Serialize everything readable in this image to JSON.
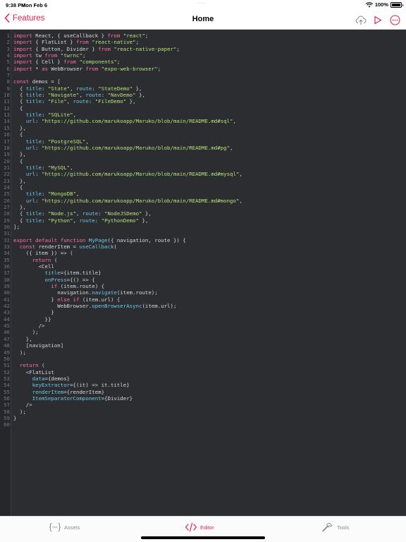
{
  "status_bar": {
    "time": "9:38 PM",
    "date": "Mon Feb 6",
    "battery": "100%",
    "battery_level": 1.0
  },
  "navbar": {
    "back_label": "Features",
    "title": "Home",
    "actions": [
      "cloud-upload-icon",
      "play-icon",
      "more-icon"
    ]
  },
  "colors": {
    "accent": "#e5254d",
    "editor_bg": "#2b2d31",
    "keyword": "#ff6fa8",
    "string": "#b6e07a",
    "property": "#6fc6e8"
  },
  "editor": {
    "lines": [
      [
        [
          "kw",
          "import"
        ],
        [
          "pl",
          " React, { useCallback } "
        ],
        [
          "kw",
          "from"
        ],
        [
          "pl",
          " "
        ],
        [
          "str",
          "\"react\""
        ],
        [
          "pl",
          ";"
        ]
      ],
      [
        [
          "kw",
          "import"
        ],
        [
          "pl",
          " { FlatList } "
        ],
        [
          "kw",
          "from"
        ],
        [
          "pl",
          " "
        ],
        [
          "str",
          "\"react-native\""
        ],
        [
          "pl",
          ";"
        ]
      ],
      [
        [
          "kw",
          "import"
        ],
        [
          "pl",
          " { Button, Divider } "
        ],
        [
          "kw",
          "from"
        ],
        [
          "pl",
          " "
        ],
        [
          "str",
          "\"react-native-paper\""
        ],
        [
          "pl",
          ";"
        ]
      ],
      [
        [
          "kw",
          "import"
        ],
        [
          "pl",
          " tw "
        ],
        [
          "kw",
          "from"
        ],
        [
          "pl",
          " "
        ],
        [
          "str",
          "\"twrnc\""
        ],
        [
          "pl",
          ";"
        ]
      ],
      [
        [
          "kw",
          "import"
        ],
        [
          "pl",
          " { Cell } "
        ],
        [
          "kw",
          "from"
        ],
        [
          "pl",
          " "
        ],
        [
          "str",
          "\"components\""
        ],
        [
          "pl",
          ";"
        ]
      ],
      [
        [
          "kw",
          "import"
        ],
        [
          "pl",
          " * "
        ],
        [
          "kw",
          "as"
        ],
        [
          "pl",
          " WebBrowser "
        ],
        [
          "kw",
          "from"
        ],
        [
          "pl",
          " "
        ],
        [
          "str",
          "\"expo-web-browser\""
        ],
        [
          "pl",
          ";"
        ]
      ],
      [],
      [
        [
          "kw",
          "const"
        ],
        [
          "pl",
          " demos = ["
        ]
      ],
      [
        [
          "pl",
          "  { "
        ],
        [
          "prop",
          "title"
        ],
        [
          "pl",
          ": "
        ],
        [
          "str",
          "\"State\""
        ],
        [
          "pl",
          ", "
        ],
        [
          "prop",
          "route"
        ],
        [
          "pl",
          ": "
        ],
        [
          "str",
          "\"StateDemo\""
        ],
        [
          "pl",
          " },"
        ]
      ],
      [
        [
          "pl",
          "  { "
        ],
        [
          "prop",
          "title"
        ],
        [
          "pl",
          ": "
        ],
        [
          "str",
          "\"Navigate\""
        ],
        [
          "pl",
          ", "
        ],
        [
          "prop",
          "route"
        ],
        [
          "pl",
          ": "
        ],
        [
          "str",
          "\"NavDemo\""
        ],
        [
          "pl",
          " },"
        ]
      ],
      [
        [
          "pl",
          "  { "
        ],
        [
          "prop",
          "title"
        ],
        [
          "pl",
          ": "
        ],
        [
          "str",
          "\"File\""
        ],
        [
          "pl",
          ", "
        ],
        [
          "prop",
          "route"
        ],
        [
          "pl",
          ": "
        ],
        [
          "str",
          "\"FileDemo\""
        ],
        [
          "pl",
          " },"
        ]
      ],
      [
        [
          "pl",
          "  {"
        ]
      ],
      [
        [
          "pl",
          "    "
        ],
        [
          "prop",
          "title"
        ],
        [
          "pl",
          ": "
        ],
        [
          "str",
          "\"SQLite\""
        ],
        [
          "pl",
          ","
        ]
      ],
      [
        [
          "pl",
          "    "
        ],
        [
          "prop",
          "url"
        ],
        [
          "pl",
          ": "
        ],
        [
          "str",
          "\"https://github.com/marukoapp/Maruko/blob/main/README.md#sql\""
        ],
        [
          "pl",
          ","
        ]
      ],
      [
        [
          "pl",
          "  },"
        ]
      ],
      [
        [
          "pl",
          "  {"
        ]
      ],
      [
        [
          "pl",
          "    "
        ],
        [
          "prop",
          "title"
        ],
        [
          "pl",
          ": "
        ],
        [
          "str",
          "\"PostgreSQL\""
        ],
        [
          "pl",
          ","
        ]
      ],
      [
        [
          "pl",
          "    "
        ],
        [
          "prop",
          "url"
        ],
        [
          "pl",
          ": "
        ],
        [
          "str",
          "\"https://github.com/marukoapp/Maruko/blob/main/README.md#pg\""
        ],
        [
          "pl",
          ","
        ]
      ],
      [
        [
          "pl",
          "  },"
        ]
      ],
      [
        [
          "pl",
          "  {"
        ]
      ],
      [
        [
          "pl",
          "    "
        ],
        [
          "prop",
          "title"
        ],
        [
          "pl",
          ": "
        ],
        [
          "str",
          "\"MySQL\""
        ],
        [
          "pl",
          ","
        ]
      ],
      [
        [
          "pl",
          "    "
        ],
        [
          "prop",
          "url"
        ],
        [
          "pl",
          ": "
        ],
        [
          "str",
          "\"https://github.com/marukoapp/Maruko/blob/main/README.md#mysql\""
        ],
        [
          "pl",
          ","
        ]
      ],
      [
        [
          "pl",
          "  },"
        ]
      ],
      [
        [
          "pl",
          "  {"
        ]
      ],
      [
        [
          "pl",
          "    "
        ],
        [
          "prop",
          "title"
        ],
        [
          "pl",
          ": "
        ],
        [
          "str",
          "\"MongoDB\""
        ],
        [
          "pl",
          ","
        ]
      ],
      [
        [
          "pl",
          "    "
        ],
        [
          "prop",
          "url"
        ],
        [
          "pl",
          ": "
        ],
        [
          "str",
          "\"https://github.com/marukoapp/Maruko/blob/main/README.md#mongo\""
        ],
        [
          "pl",
          ","
        ]
      ],
      [
        [
          "pl",
          "  },"
        ]
      ],
      [
        [
          "pl",
          "  { "
        ],
        [
          "prop",
          "title"
        ],
        [
          "pl",
          ": "
        ],
        [
          "str",
          "\"Node.js\""
        ],
        [
          "pl",
          ", "
        ],
        [
          "prop",
          "route"
        ],
        [
          "pl",
          ": "
        ],
        [
          "str",
          "\"NodeJSDemo\""
        ],
        [
          "pl",
          " },"
        ]
      ],
      [
        [
          "pl",
          "  { "
        ],
        [
          "prop",
          "title"
        ],
        [
          "pl",
          ": "
        ],
        [
          "str",
          "\"Python\""
        ],
        [
          "pl",
          ", "
        ],
        [
          "prop",
          "route"
        ],
        [
          "pl",
          ": "
        ],
        [
          "str",
          "\"PythonDemo\""
        ],
        [
          "pl",
          " },"
        ]
      ],
      [
        [
          "pl",
          "];"
        ]
      ],
      [],
      [
        [
          "kw",
          "export default function"
        ],
        [
          "pl",
          " "
        ],
        [
          "fn",
          "MyPage"
        ],
        [
          "pl",
          "({ navigation, route }) {"
        ]
      ],
      [
        [
          "pl",
          "  "
        ],
        [
          "kw",
          "const"
        ],
        [
          "pl",
          " renderItem = "
        ],
        [
          "fn",
          "useCallback"
        ],
        [
          "pl",
          "("
        ]
      ],
      [
        [
          "pl",
          "    ({ item }) => ("
        ]
      ],
      [
        [
          "pl",
          "      "
        ],
        [
          "kw",
          "return"
        ],
        [
          "pl",
          " ("
        ]
      ],
      [
        [
          "pl",
          "        <Cell"
        ]
      ],
      [
        [
          "pl",
          "          "
        ],
        [
          "prop",
          "title"
        ],
        [
          "pl",
          "={item.title}"
        ]
      ],
      [
        [
          "pl",
          "          "
        ],
        [
          "prop",
          "onPress"
        ],
        [
          "pl",
          "={() => {"
        ]
      ],
      [
        [
          "pl",
          "            "
        ],
        [
          "kw",
          "if"
        ],
        [
          "pl",
          " (item.route) {"
        ]
      ],
      [
        [
          "pl",
          "              navigation."
        ],
        [
          "fn",
          "navigate"
        ],
        [
          "pl",
          "(item.route);"
        ]
      ],
      [
        [
          "pl",
          "            } "
        ],
        [
          "kw",
          "else if"
        ],
        [
          "pl",
          " (item.url) {"
        ]
      ],
      [
        [
          "pl",
          "              WebBrowser."
        ],
        [
          "fn",
          "openBrowserAsync"
        ],
        [
          "pl",
          "(item.url);"
        ]
      ],
      [
        [
          "pl",
          "            }"
        ]
      ],
      [
        [
          "pl",
          "          }}"
        ]
      ],
      [
        [
          "pl",
          "        />"
        ]
      ],
      [
        [
          "pl",
          "      );"
        ]
      ],
      [
        [
          "pl",
          "    },"
        ]
      ],
      [
        [
          "pl",
          "    [navigation]"
        ]
      ],
      [
        [
          "pl",
          "  );"
        ]
      ],
      [],
      [
        [
          "pl",
          "  "
        ],
        [
          "kw",
          "return"
        ],
        [
          "pl",
          " ("
        ]
      ],
      [
        [
          "pl",
          "    <FlatList"
        ]
      ],
      [
        [
          "pl",
          "      "
        ],
        [
          "prop",
          "data"
        ],
        [
          "pl",
          "={demos}"
        ]
      ],
      [
        [
          "pl",
          "      "
        ],
        [
          "prop",
          "keyExtractor"
        ],
        [
          "pl",
          "={(it) => it.title}"
        ]
      ],
      [
        [
          "pl",
          "      "
        ],
        [
          "prop",
          "renderItem"
        ],
        [
          "pl",
          "={renderItem}"
        ]
      ],
      [
        [
          "pl",
          "      "
        ],
        [
          "prop",
          "ItemSeparatorComponent"
        ],
        [
          "pl",
          "={Divider}"
        ]
      ],
      [
        [
          "pl",
          "    />"
        ]
      ],
      [
        [
          "pl",
          "  );"
        ]
      ],
      [
        [
          "pl",
          "}"
        ]
      ],
      []
    ]
  },
  "tabbar": {
    "tabs": [
      {
        "label": "Assets",
        "icon": "assets-braces-icon",
        "active": false
      },
      {
        "label": "Editor",
        "icon": "code-icon",
        "active": true
      },
      {
        "label": "Tools",
        "icon": "hammer-icon",
        "active": false
      }
    ]
  }
}
